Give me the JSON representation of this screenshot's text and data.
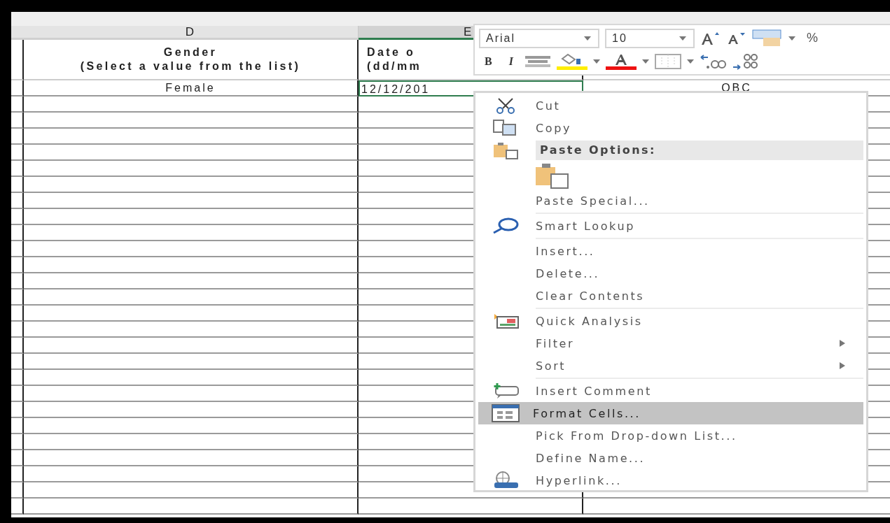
{
  "columns": [
    {
      "label": "D",
      "selected": false
    },
    {
      "label": "E",
      "selected": true
    }
  ],
  "header_cells": [
    {
      "title": "Gender",
      "subtitle": "(Select a value from the list)"
    },
    {
      "title": "Date o",
      "subtitle": "(dd/mm"
    }
  ],
  "rows": [
    {
      "cells": [
        {
          "text": "Female",
          "selected": false
        },
        {
          "text": "12/12/201",
          "selected": true
        },
        {
          "text": "OBC",
          "selected": false
        }
      ]
    }
  ],
  "mini_toolbar": {
    "font": "Arial",
    "size": "10",
    "top_buttons": [
      {
        "kind": "grow_font"
      },
      {
        "kind": "shrink_font"
      },
      {
        "kind": "number_format"
      },
      {
        "kind": "dropdown"
      },
      {
        "kind": "percent",
        "text": "%"
      }
    ],
    "bottom_buttons": [
      {
        "kind": "bold",
        "text": "B"
      },
      {
        "kind": "italic",
        "text": "I"
      },
      {
        "kind": "align_center"
      },
      {
        "kind": "fill_color",
        "color": "#ffee00"
      },
      {
        "kind": "dropdown"
      },
      {
        "kind": "font_color",
        "color": "#ee1111"
      },
      {
        "kind": "dropdown"
      },
      {
        "kind": "borders"
      },
      {
        "kind": "dropdown"
      },
      {
        "kind": "increase_decimal"
      },
      {
        "kind": "decrease_decimal"
      }
    ]
  },
  "context_menu": {
    "items": [
      {
        "kind": "item",
        "label": "Cut",
        "selected": false,
        "submenu": false
      },
      {
        "kind": "item",
        "label": "Copy",
        "selected": false,
        "submenu": false
      },
      {
        "kind": "header",
        "label": "Paste Options:"
      },
      {
        "kind": "paste_icons"
      },
      {
        "kind": "item",
        "label": "Paste Special...",
        "selected": false,
        "submenu": false
      },
      {
        "kind": "separator"
      },
      {
        "kind": "item",
        "label": "Smart Lookup",
        "selected": false,
        "submenu": false
      },
      {
        "kind": "separator"
      },
      {
        "kind": "item",
        "label": "Insert...",
        "selected": false,
        "submenu": false
      },
      {
        "kind": "item",
        "label": "Delete...",
        "selected": false,
        "submenu": false
      },
      {
        "kind": "item",
        "label": "Clear Contents",
        "selected": false,
        "submenu": false
      },
      {
        "kind": "separator"
      },
      {
        "kind": "item",
        "label": "Quick Analysis",
        "selected": false,
        "submenu": false
      },
      {
        "kind": "item",
        "label": "Filter",
        "selected": false,
        "submenu": true
      },
      {
        "kind": "item",
        "label": "Sort",
        "selected": false,
        "submenu": true
      },
      {
        "kind": "separator"
      },
      {
        "kind": "item",
        "label": "Insert Comment",
        "selected": false,
        "submenu": false
      },
      {
        "kind": "item",
        "label": "Format Cells...",
        "selected": true,
        "submenu": false
      },
      {
        "kind": "item",
        "label": "Pick From Drop-down List...",
        "selected": false,
        "submenu": false
      },
      {
        "kind": "item",
        "label": "Define Name...",
        "selected": false,
        "submenu": false
      },
      {
        "kind": "item",
        "label": "Hyperlink...",
        "selected": false,
        "submenu": false
      }
    ]
  }
}
